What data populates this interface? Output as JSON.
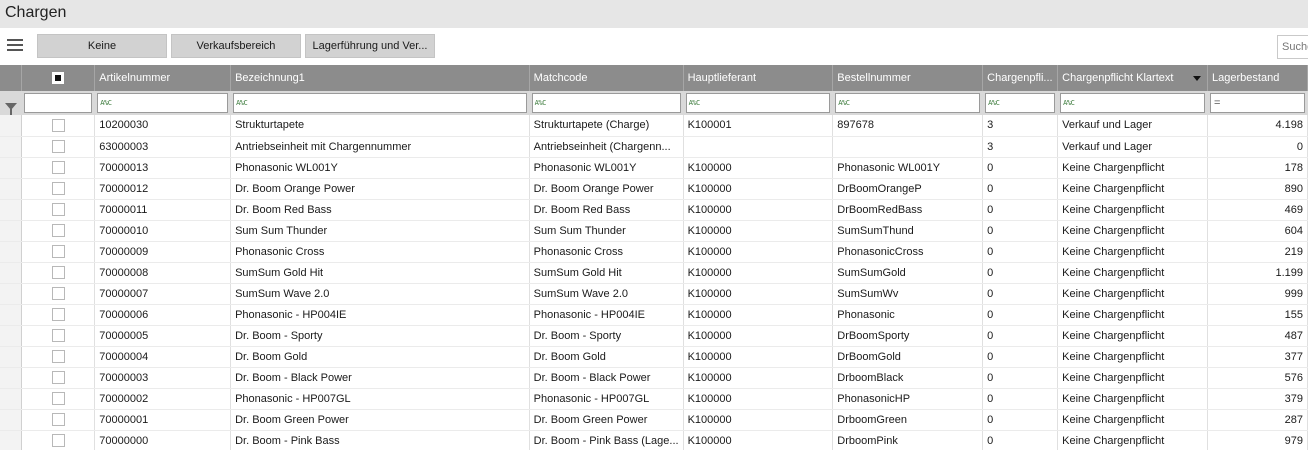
{
  "window": {
    "title": "Chargen"
  },
  "toolbar": {
    "buttons": [
      "Keine",
      "Verkaufsbereich",
      "Lagerführung und Ver..."
    ],
    "search_placeholder": "Suche"
  },
  "table": {
    "columns": [
      "Artikelnummer",
      "Bezeichnung1",
      "Matchcode",
      "Hauptlieferant",
      "Bestellnummer",
      "Chargenpfli...",
      "Chargenpflicht Klartext",
      "Lagerbestand"
    ],
    "filter_glyph": "A%C",
    "filter_glyph_eq": "=",
    "rows": [
      [
        "10200030",
        "Strukturtapete",
        "Strukturtapete (Charge)",
        "K100001",
        "897678",
        "3",
        "Verkauf und Lager",
        "4.198"
      ],
      [
        "63000003",
        "Antriebseinheit mit Chargennummer",
        "Antriebseinheit (Chargenn...",
        "",
        "",
        "3",
        "Verkauf und Lager",
        "0"
      ],
      [
        "70000013",
        "Phonasonic WL001Y",
        "Phonasonic WL001Y",
        "K100000",
        "Phonasonic WL001Y",
        "0",
        "Keine Chargenpflicht",
        "178"
      ],
      [
        "70000012",
        "Dr. Boom Orange Power",
        "Dr. Boom Orange Power",
        "K100000",
        "DrBoomOrangeP",
        "0",
        "Keine Chargenpflicht",
        "890"
      ],
      [
        "70000011",
        "Dr. Boom Red Bass",
        "Dr. Boom Red Bass",
        "K100000",
        "DrBoomRedBass",
        "0",
        "Keine Chargenpflicht",
        "469"
      ],
      [
        "70000010",
        "Sum Sum Thunder",
        "Sum Sum Thunder",
        "K100000",
        "SumSumThund",
        "0",
        "Keine Chargenpflicht",
        "604"
      ],
      [
        "70000009",
        "Phonasonic Cross",
        "Phonasonic Cross",
        "K100000",
        "PhonasonicCross",
        "0",
        "Keine Chargenpflicht",
        "219"
      ],
      [
        "70000008",
        "SumSum Gold Hit",
        "SumSum Gold Hit",
        "K100000",
        "SumSumGold",
        "0",
        "Keine Chargenpflicht",
        "1.199"
      ],
      [
        "70000007",
        "SumSum Wave 2.0",
        "SumSum Wave 2.0",
        "K100000",
        "SumSumWv",
        "0",
        "Keine Chargenpflicht",
        "999"
      ],
      [
        "70000006",
        "Phonasonic - HP004IE",
        "Phonasonic - HP004IE",
        "K100000",
        "Phonasonic",
        "0",
        "Keine Chargenpflicht",
        "155"
      ],
      [
        "70000005",
        "Dr. Boom - Sporty",
        "Dr. Boom - Sporty",
        "K100000",
        "DrBoomSporty",
        "0",
        "Keine Chargenpflicht",
        "487"
      ],
      [
        "70000004",
        "Dr. Boom Gold",
        "Dr. Boom Gold",
        "K100000",
        "DrBoomGold",
        "0",
        "Keine Chargenpflicht",
        "377"
      ],
      [
        "70000003",
        "Dr. Boom - Black Power",
        "Dr. Boom - Black Power",
        "K100000",
        "DrboomBlack",
        "0",
        "Keine Chargenpflicht",
        "576"
      ],
      [
        "70000002",
        "Phonasonic - HP007GL",
        "Phonasonic - HP007GL",
        "K100000",
        "PhonasonicHP",
        "0",
        "Keine Chargenpflicht",
        "379"
      ],
      [
        "70000001",
        "Dr. Boom Green Power",
        "Dr. Boom Green Power",
        "K100000",
        "DrboomGreen",
        "0",
        "Keine Chargenpflicht",
        "287"
      ],
      [
        "70000000",
        "Dr. Boom - Pink Bass",
        "Dr. Boom - Pink Bass (Lage...",
        "K100000",
        "DrboomPink",
        "0",
        "Keine Chargenpflicht",
        "979"
      ]
    ]
  }
}
